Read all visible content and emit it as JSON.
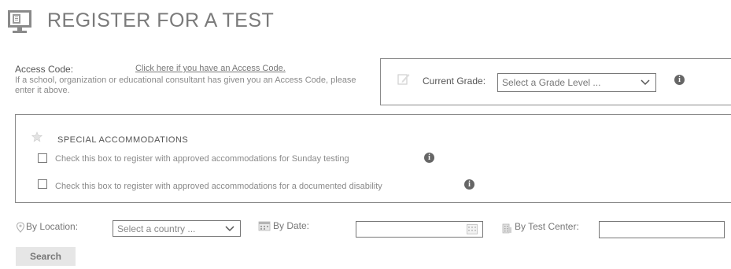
{
  "header": {
    "title": "REGISTER FOR A TEST",
    "icon": "monitor-document-icon"
  },
  "access_code": {
    "label": "Access Code:",
    "link": "Click here if you have an Access Code.",
    "help": "If a school, organization or educational consultant has given you an Access Code, please enter it above."
  },
  "grade": {
    "label": "Current Grade:",
    "selected": "Select a Grade Level ...",
    "icon": "pencil-icon",
    "info_icon": "info-icon"
  },
  "accommodations": {
    "title": "SPECIAL ACCOMMODATIONS",
    "icon": "star-icon",
    "options": [
      {
        "label": "Check this box to register with approved accommodations for Sunday testing",
        "checked": false
      },
      {
        "label": "Check this box to register with approved accommodations for a documented disability",
        "checked": false
      }
    ]
  },
  "search_bar": {
    "location_label": "By Location:",
    "country_selected": "Select a country ...",
    "date_label": "By Date:",
    "date_value": "",
    "center_label": "By Test Center:",
    "center_value": "",
    "search_label": "Search"
  },
  "colors": {
    "border": "#8a8a8a",
    "text": "#555555",
    "button_bg": "#e6e6e6"
  }
}
